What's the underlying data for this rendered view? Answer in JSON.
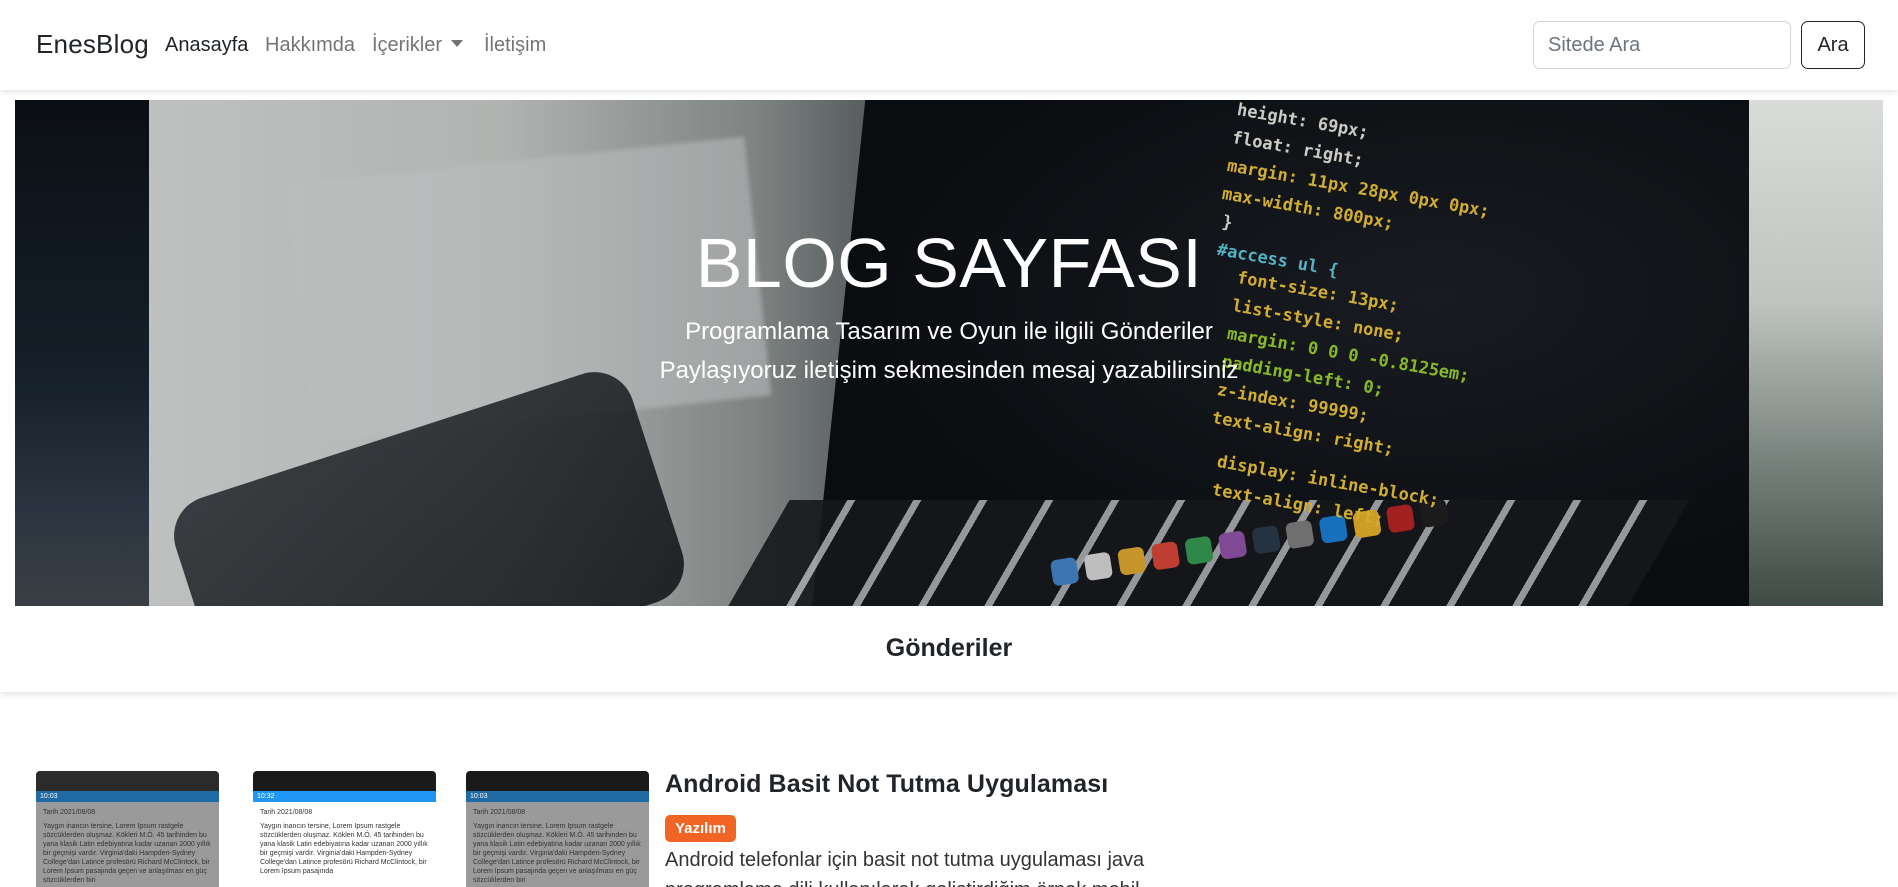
{
  "navbar": {
    "brand": "EnesBlog",
    "links": [
      {
        "label": "Anasayfa",
        "active": true
      },
      {
        "label": "Hakkımda",
        "active": false
      },
      {
        "label": "İçerikler",
        "active": false,
        "dropdown": true
      },
      {
        "label": "İletişim",
        "active": false
      }
    ],
    "search": {
      "placeholder": "Sitede Ara",
      "value": "",
      "button_label": "Ara"
    }
  },
  "hero": {
    "title": "BLOG SAYFASI",
    "subtitle_line1": "Programlama Tasarım ve Oyun ile ilgili Gönderiler",
    "subtitle_line2": "Paylaşıyoruz iletişim sekmesinden mesaj yazabilirsiniz",
    "code_lines": [
      "height: 69px;",
      "float: right;",
      "margin: 11px 28px 0px 0px;",
      "max-width: 800px;",
      "}",
      "#access ul {",
      "font-size: 13px;",
      "list-style: none;",
      "margin: 0 0 0 -0.8125em;",
      "padding-left: 0;",
      "z-index: 99999;",
      "text-align: right;",
      "display: inline-block;",
      "text-align: left;"
    ]
  },
  "section": {
    "title": "Gönderiler"
  },
  "posts": [
    {
      "title": "Android Basit Not Tutma Uygulaması",
      "category": "Yazılım",
      "excerpt": "Android telefonlar için basit not tutma uygulaması java programlama dili kullanılarak geliştirdiğim örnek mobil",
      "thumbnails": [
        {
          "status_time": "10:03",
          "date": "Tarih 2021/08/08",
          "text": "Yaygın inancın tersine, Lorem Ipsum rastgele sözcüklerden oluşmaz. Kökleri M.Ö. 45 tarihinden bu yana klasik Latin edebiyatına kadar uzanan 2000 yıllık bir geçmişi vardır. Virginia'daki Hampden-Sydney College'dan Latince profesörü Richard McClintock, bir Lorem Ipsum pasajında geçen ve anlaşılması en güç sözcüklerden biri"
        },
        {
          "status_time": "10:32",
          "date": "Tarih 2021/08/08",
          "text": "Yaygın inancın tersine, Lorem Ipsum rastgele sözcüklerden oluşmaz. Kökleri M.Ö. 45 tarihinden bu yana klasik Latin edebiyatına kadar uzanan 2000 yıllık bir geçmişi vardır. Virginia'daki Hampden-Sydney College'dan Latince profesörü Richard McClintock, bir Lorem Ipsum pasajında"
        },
        {
          "status_time": "10:03",
          "date": "Tarih 2021/08/08",
          "text": "Yaygın inancın tersine, Lorem Ipsum rastgele sözcüklerden oluşmaz. Kökleri M.Ö. 45 tarihinden bu yana klasik Latin edebiyatına kadar uzanan 2000 yıllık bir geçmişi vardır. Virginia'daki Hampden-Sydney College'dan Latince profesörü Richard McClintock, bir Lorem Ipsum pasajında geçen ve anlaşılması en güç sözcüklerden biri"
        }
      ]
    }
  ],
  "colors": {
    "badge": "#f06424",
    "code_keyword": "#ffd33d",
    "code_value": "#a6e22e",
    "code_selector": "#66d9ef",
    "code_prop": "#f8f8f2",
    "status_bar_dark": "#1f6aa5",
    "status_bar_light": "#2196f3"
  },
  "icons": [
    "caret-down-icon"
  ]
}
